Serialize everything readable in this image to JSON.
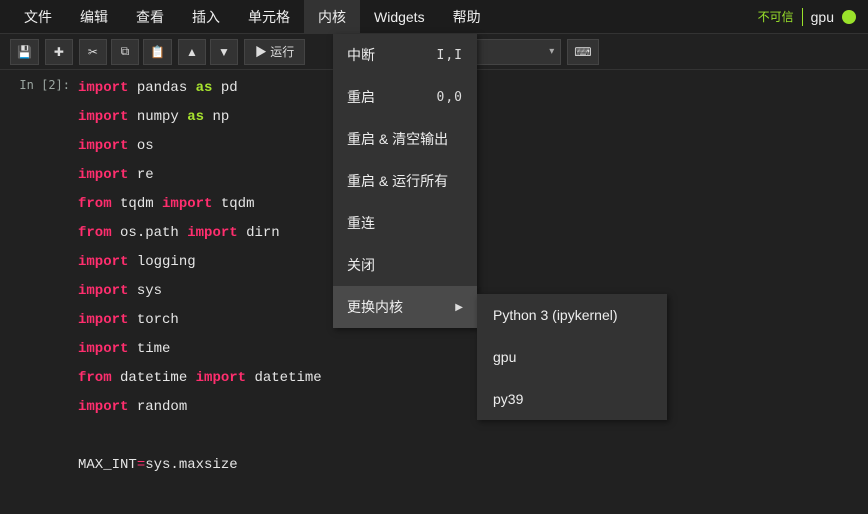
{
  "menubar": {
    "items": [
      "文件",
      "编辑",
      "查看",
      "插入",
      "单元格",
      "内核",
      "Widgets",
      "帮助"
    ],
    "active_index": 5,
    "untrusted": "不可信",
    "kernel_name": "gpu"
  },
  "toolbar": {
    "save": "💾",
    "add": "✚",
    "cut": "✂",
    "copy": "⧉",
    "paste": "📋",
    "up": "▲",
    "down": "▼",
    "run_label": "▶ 运行",
    "keyboard": "⌨"
  },
  "cell": {
    "prompt": "In [2]:",
    "code_lines": [
      {
        "tokens": [
          {
            "t": "import",
            "c": "k-red"
          },
          {
            "t": " ",
            "c": "ident"
          },
          {
            "t": "pandas",
            "c": "ident"
          },
          {
            "t": " ",
            "c": "ident"
          },
          {
            "t": "as",
            "c": "k-green"
          },
          {
            "t": " ",
            "c": "ident"
          },
          {
            "t": "pd",
            "c": "ident"
          }
        ]
      },
      {
        "tokens": [
          {
            "t": "import",
            "c": "k-red"
          },
          {
            "t": " ",
            "c": "ident"
          },
          {
            "t": "numpy",
            "c": "ident"
          },
          {
            "t": " ",
            "c": "ident"
          },
          {
            "t": "as",
            "c": "k-green"
          },
          {
            "t": " ",
            "c": "ident"
          },
          {
            "t": "np",
            "c": "ident"
          }
        ]
      },
      {
        "tokens": [
          {
            "t": "import",
            "c": "k-red"
          },
          {
            "t": " ",
            "c": "ident"
          },
          {
            "t": "os",
            "c": "ident"
          }
        ]
      },
      {
        "tokens": [
          {
            "t": "import",
            "c": "k-red"
          },
          {
            "t": " ",
            "c": "ident"
          },
          {
            "t": "re",
            "c": "ident"
          }
        ]
      },
      {
        "tokens": [
          {
            "t": "from",
            "c": "k-red"
          },
          {
            "t": " ",
            "c": "ident"
          },
          {
            "t": "tqdm",
            "c": "ident"
          },
          {
            "t": " ",
            "c": "ident"
          },
          {
            "t": "import",
            "c": "k-red"
          },
          {
            "t": " ",
            "c": "ident"
          },
          {
            "t": "tqdm",
            "c": "ident"
          }
        ]
      },
      {
        "tokens": [
          {
            "t": "from",
            "c": "k-red"
          },
          {
            "t": " ",
            "c": "ident"
          },
          {
            "t": "os.path",
            "c": "ident"
          },
          {
            "t": " ",
            "c": "ident"
          },
          {
            "t": "import",
            "c": "k-red"
          },
          {
            "t": " ",
            "c": "ident"
          },
          {
            "t": "dirn",
            "c": "ident"
          }
        ]
      },
      {
        "tokens": [
          {
            "t": "import",
            "c": "k-red"
          },
          {
            "t": " ",
            "c": "ident"
          },
          {
            "t": "logging",
            "c": "ident"
          }
        ]
      },
      {
        "tokens": [
          {
            "t": "import",
            "c": "k-red"
          },
          {
            "t": " ",
            "c": "ident"
          },
          {
            "t": "sys",
            "c": "ident"
          }
        ]
      },
      {
        "tokens": [
          {
            "t": "import",
            "c": "k-red"
          },
          {
            "t": " ",
            "c": "ident"
          },
          {
            "t": "torch",
            "c": "ident"
          }
        ]
      },
      {
        "tokens": [
          {
            "t": "import",
            "c": "k-red"
          },
          {
            "t": " ",
            "c": "ident"
          },
          {
            "t": "time",
            "c": "ident"
          }
        ]
      },
      {
        "tokens": [
          {
            "t": "from",
            "c": "k-red"
          },
          {
            "t": " ",
            "c": "ident"
          },
          {
            "t": "datetime",
            "c": "ident"
          },
          {
            "t": " ",
            "c": "ident"
          },
          {
            "t": "import",
            "c": "k-red"
          },
          {
            "t": " ",
            "c": "ident"
          },
          {
            "t": "datetime",
            "c": "ident"
          }
        ]
      },
      {
        "tokens": [
          {
            "t": "import",
            "c": "k-red"
          },
          {
            "t": " ",
            "c": "ident"
          },
          {
            "t": "random",
            "c": "ident"
          }
        ]
      },
      {
        "blank": true
      },
      {
        "tokens": [
          {
            "t": "MAX_INT",
            "c": "ident"
          },
          {
            "t": "=",
            "c": "op"
          },
          {
            "t": "sys.maxsize",
            "c": "ident"
          }
        ]
      }
    ]
  },
  "kernel_menu": {
    "items": [
      {
        "label": "中断",
        "shortcut": "I,I"
      },
      {
        "label": "重启",
        "shortcut": "0,0"
      },
      {
        "label": "重启 & 清空输出"
      },
      {
        "label": "重启 & 运行所有"
      },
      {
        "label": "重连"
      },
      {
        "label": "关闭"
      },
      {
        "label": "更换内核",
        "submenu": true,
        "hover": true
      }
    ],
    "kernel_options": [
      "Python 3 (ipykernel)",
      "gpu",
      "py39"
    ]
  }
}
